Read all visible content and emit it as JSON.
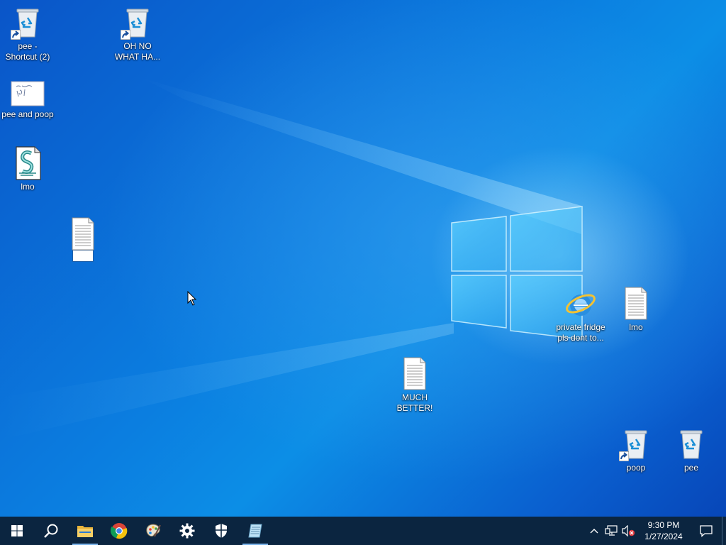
{
  "desktop": {
    "icons": [
      {
        "label": "pee - Shortcut (2)",
        "icon": "recycle-bin-icon",
        "shortcut": true
      },
      {
        "label": "OH NO WHAT HA...",
        "icon": "recycle-bin-icon",
        "shortcut": true
      },
      {
        "label": "pee and poop",
        "icon": "image-thumbnail-icon"
      },
      {
        "label": "lmo",
        "icon": "script-file-icon"
      },
      {
        "label": "",
        "icon": "text-document-icon",
        "renaming": true
      },
      {
        "label": "private fridge pls dont to...",
        "icon": "internet-explorer-icon"
      },
      {
        "label": "lmo",
        "icon": "text-document-icon"
      },
      {
        "label": "MUCH BETTER!",
        "icon": "text-document-icon"
      },
      {
        "label": "poop",
        "icon": "recycle-bin-icon",
        "shortcut": true
      },
      {
        "label": "pee",
        "icon": "recycle-bin-icon"
      }
    ]
  },
  "taskbar": {
    "buttons": [
      {
        "name": "start",
        "icon": "windows-logo-icon"
      },
      {
        "name": "search",
        "icon": "search-icon"
      },
      {
        "name": "file-explorer",
        "icon": "folder-icon",
        "open": true
      },
      {
        "name": "chrome",
        "icon": "chrome-icon"
      },
      {
        "name": "paint",
        "icon": "paint-palette-icon"
      },
      {
        "name": "settings",
        "icon": "gear-icon"
      },
      {
        "name": "windows-security",
        "icon": "shield-icon"
      },
      {
        "name": "notepad",
        "icon": "notepad-icon",
        "open": true
      }
    ],
    "tray": {
      "time": "9:30 PM",
      "date": "1/27/2024",
      "icons": [
        "chevron-up-icon",
        "network-icon",
        "volume-muted-icon"
      ]
    }
  },
  "colors": {
    "taskbar": "#0b2540",
    "desktop_accent": "#0b7ee0"
  }
}
